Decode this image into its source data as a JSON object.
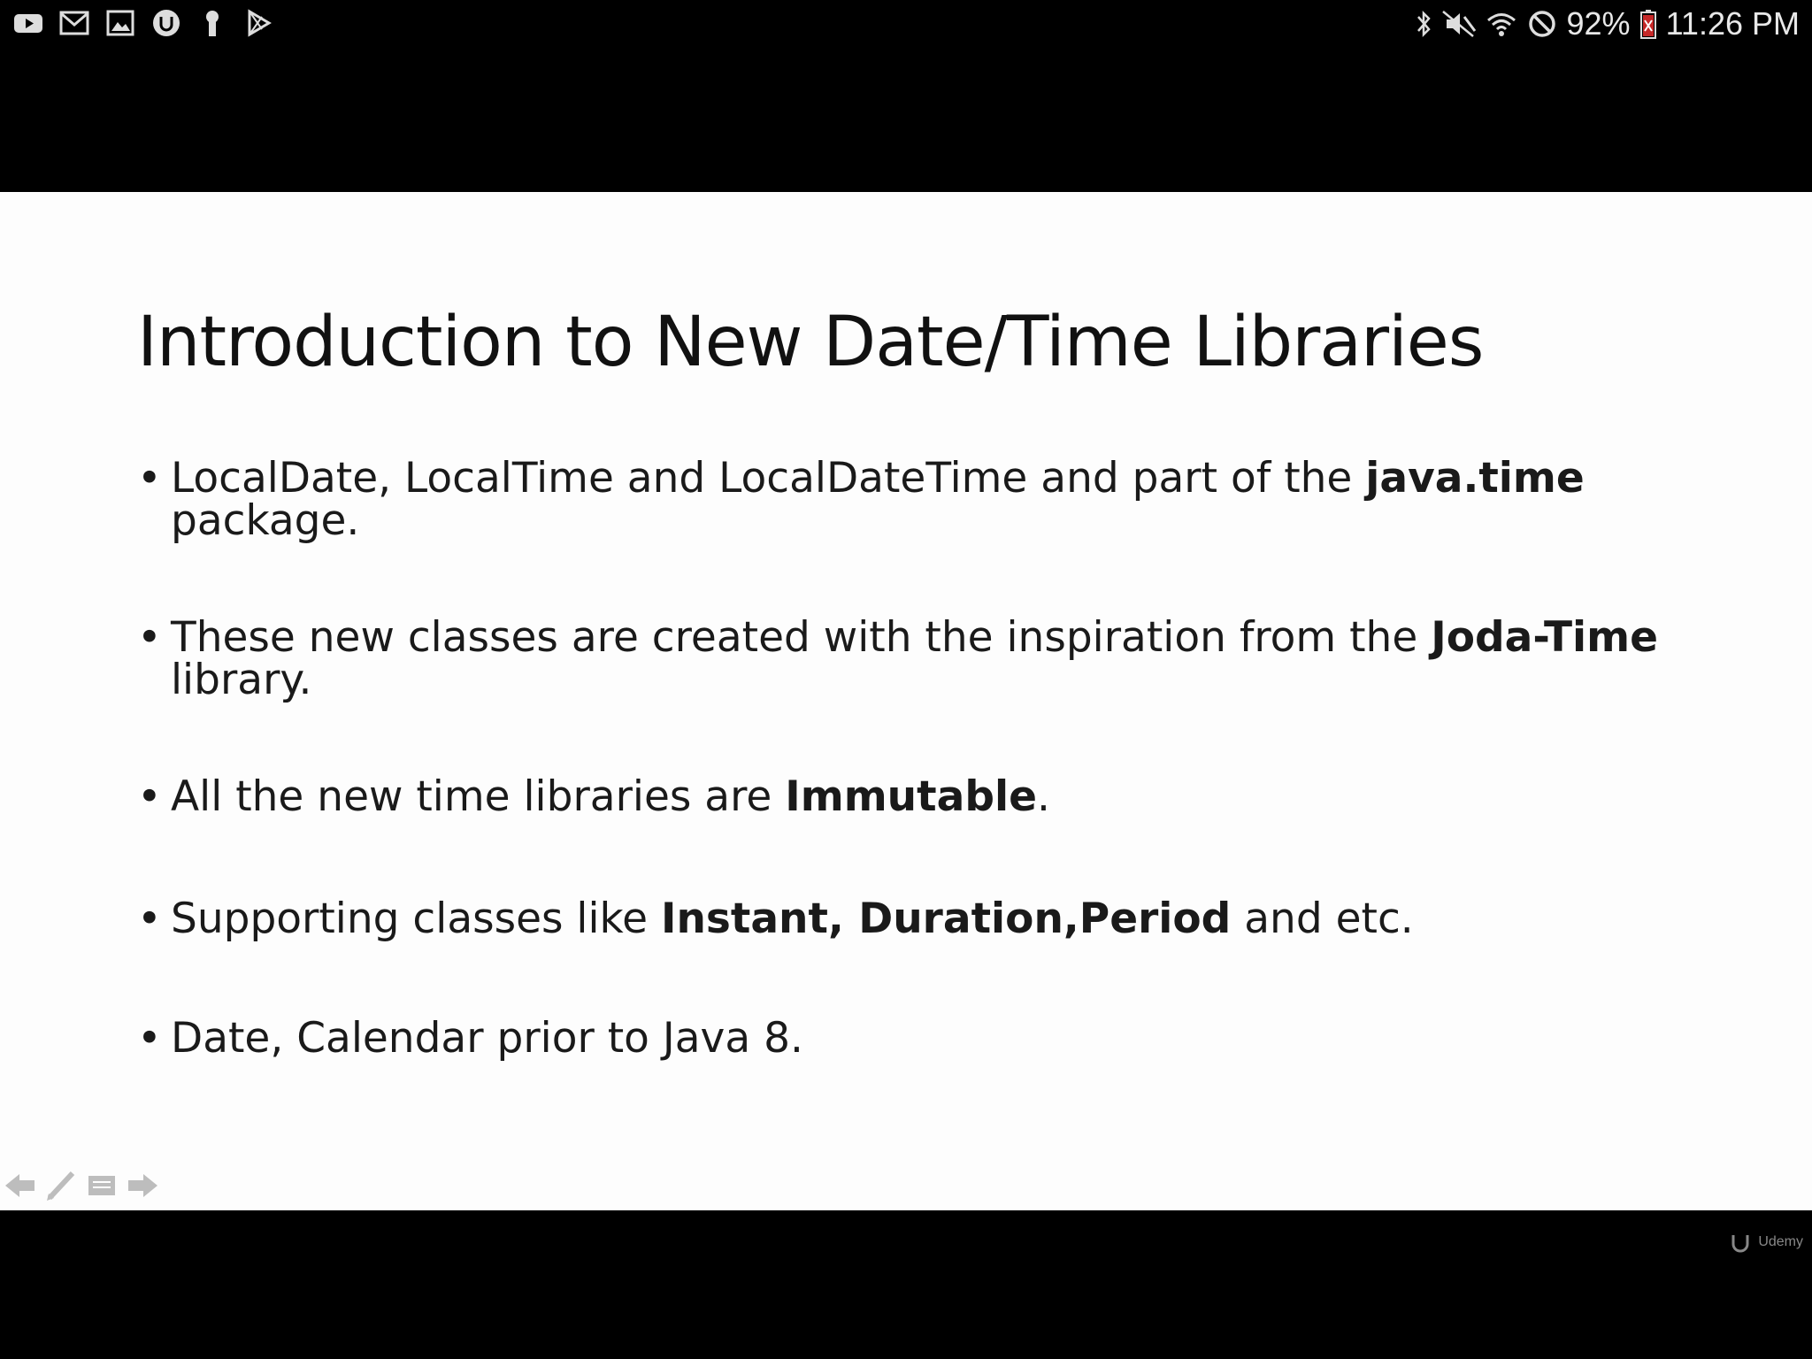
{
  "status_bar": {
    "notification_icons": [
      "youtube-icon",
      "gmail-icon",
      "gallery-icon",
      "udemy-icon",
      "keyhole-icon",
      "play-store-icon"
    ],
    "system_icons": [
      "bluetooth-icon",
      "mute-icon",
      "wifi-icon",
      "do-not-disturb-icon"
    ],
    "battery_percent": "92%",
    "time": "11:26 PM"
  },
  "slide": {
    "title": "Introduction to New Date/Time Libraries",
    "bullets": [
      {
        "pre": "LocalDate, LocalTime and LocalDateTime and part of the ",
        "bold": "java.time",
        "post": " package."
      },
      {
        "pre": "These new classes are created with the inspiration from the ",
        "bold": "Joda-Time",
        "post": " library."
      },
      {
        "pre": "All the new time libraries are ",
        "bold": "Immutable",
        "post": "."
      },
      {
        "pre": "Supporting classes like ",
        "bold": "Instant, Duration,Period",
        "post": " and etc."
      },
      {
        "pre": "Date, Calendar prior to Java 8.",
        "bold": "",
        "post": ""
      }
    ]
  },
  "controls": [
    "previous-arrow-icon",
    "pen-icon",
    "menu-icon",
    "next-arrow-icon"
  ],
  "watermark": {
    "text": "Udemy"
  },
  "colors": {
    "background": "#000000",
    "slide": "#fdfdfd",
    "text": "#1a1a1a"
  }
}
